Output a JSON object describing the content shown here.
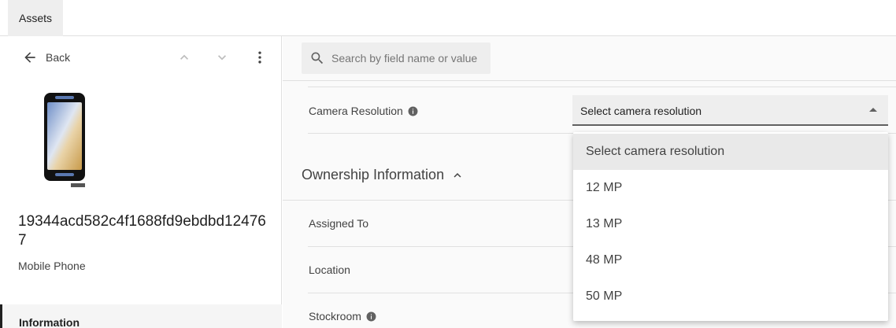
{
  "top_tabs": [
    {
      "label": "Assets"
    }
  ],
  "left_panel": {
    "back_label": "Back",
    "asset_id": "19344acd582c4f1688fd9ebdbd124767",
    "asset_type": "Mobile Phone",
    "nav_items": [
      {
        "label": "Information",
        "active": true
      }
    ]
  },
  "search": {
    "placeholder": "Search by field name or value"
  },
  "fields": {
    "camera_resolution": {
      "label": "Camera Resolution",
      "value": "Select camera resolution"
    }
  },
  "sections": {
    "ownership": {
      "title": "Ownership Information",
      "fields": [
        {
          "label": "Assigned To"
        },
        {
          "label": "Location"
        },
        {
          "label": "Stockroom"
        }
      ]
    }
  },
  "dropdown": {
    "options": [
      "Select camera resolution",
      "12 MP",
      "13 MP",
      "48 MP",
      "50 MP"
    ],
    "selected_index": 0
  },
  "colors": {
    "accent": "#212121",
    "surface": "#eeeeee",
    "divider": "#e0e0e0"
  }
}
